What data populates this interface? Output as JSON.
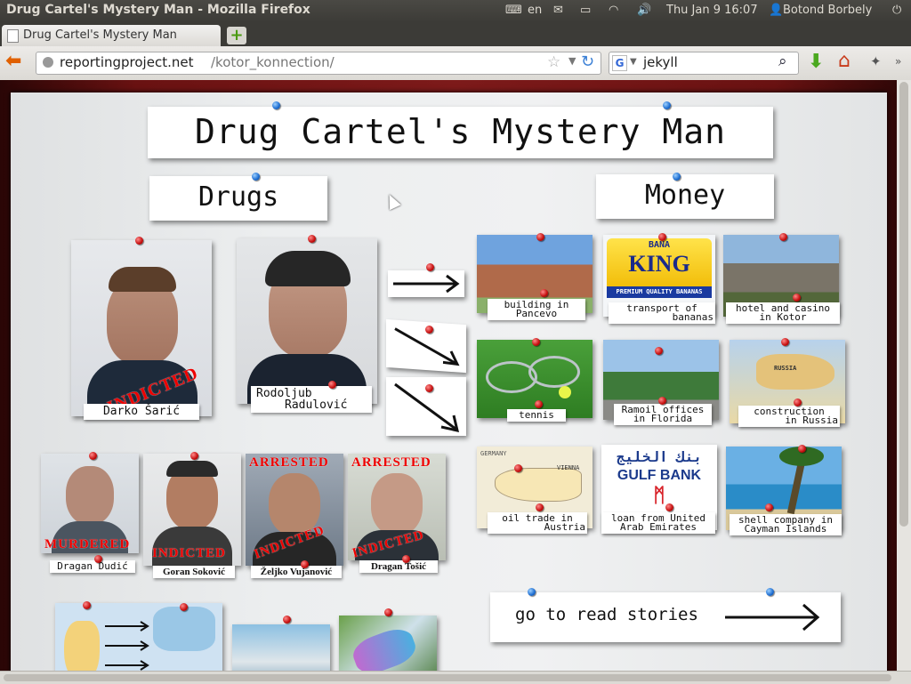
{
  "window": {
    "title": "Drug Cartel's Mystery Man - Mozilla Firefox"
  },
  "panel": {
    "keyboard": "en",
    "datetime": "Thu Jan  9 16:07",
    "user": "Botond Borbely"
  },
  "tab": {
    "label": "Drug Cartel's Mystery Man"
  },
  "nav": {
    "url_domain": "reportingproject.net",
    "url_path": "/kotor_konnection/",
    "search_value": "jekyll",
    "search_engine": "G"
  },
  "page": {
    "title": "Drug Cartel's Mystery Man",
    "section_drugs": "Drugs",
    "section_money": "Money",
    "people_main": [
      {
        "name": "Darko Šarić",
        "stamp": "INDICTED"
      },
      {
        "name": "Rodoljub Radulović",
        "name_line1": "Rodoljub",
        "name_line2": "Radulović",
        "stamp": ""
      }
    ],
    "people_small": [
      {
        "name": "Dragan Dudić",
        "stamp": "MURDERED",
        "top_stamp": ""
      },
      {
        "name": "Goran Soković",
        "stamp": "INDICTED",
        "top_stamp": ""
      },
      {
        "name": "Željko Vujanović",
        "stamp": "INDICTED",
        "top_stamp": "ARRESTED"
      },
      {
        "name": "Dragan Tošić",
        "stamp": "INDICTED",
        "top_stamp": "ARRESTED"
      }
    ],
    "money_items": [
      {
        "line1": "building in",
        "line2": "Pancevo"
      },
      {
        "line1": "transport of",
        "line2": "bananas"
      },
      {
        "line1": "hotel and casino",
        "line2": "in Kotor"
      },
      {
        "line1": "tennis",
        "line2": ""
      },
      {
        "line1": "Ramoil offices",
        "line2": "in Florida"
      },
      {
        "line1": "construction",
        "line2": "in Russia"
      },
      {
        "line1": "oil trade in",
        "line2": "Austria"
      },
      {
        "line1": "loan from United",
        "line2": "Arab Emirates"
      },
      {
        "line1": "shell company in",
        "line2": "Cayman Islands"
      }
    ],
    "banana_logo": {
      "top": "BANA",
      "main": "KING",
      "bottom": "PREMIUM QUALITY BANANAS"
    },
    "gulf_bank": {
      "arabic": "بنك الخليج",
      "english": "GULF BANK"
    },
    "map_labels": {
      "russia": "RUSSIA",
      "germany": "GERMANY",
      "vienna": "VIENNA"
    },
    "read_stories": "go to read stories"
  }
}
